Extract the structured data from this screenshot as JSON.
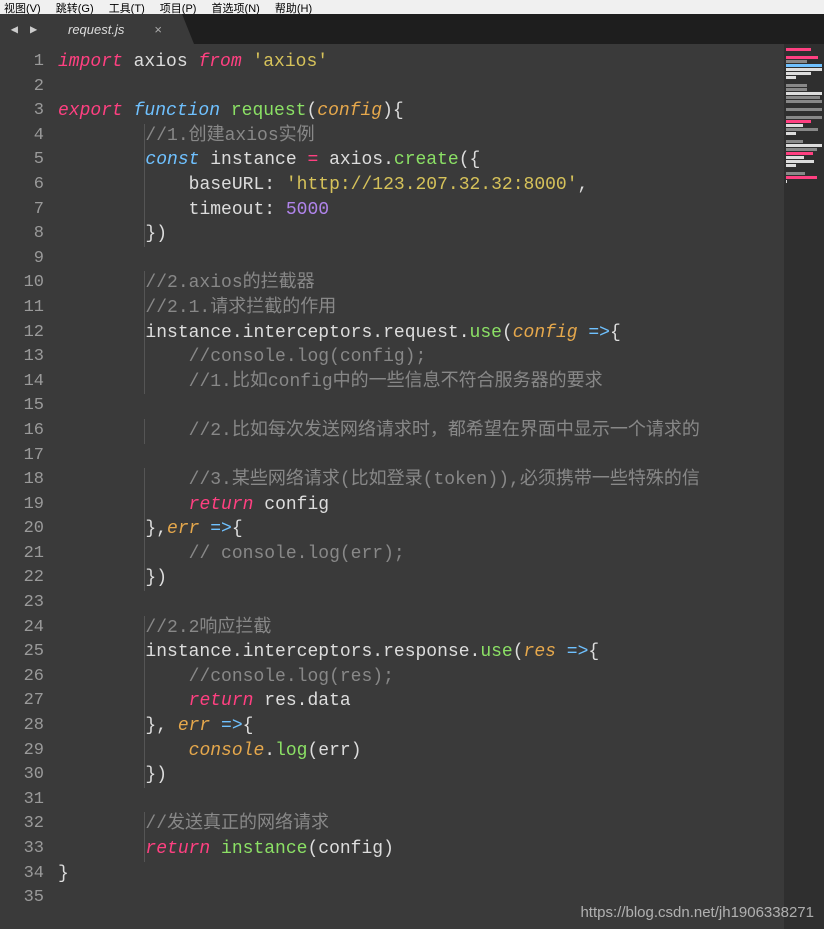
{
  "menubar": {
    "items": [
      "视图(V)",
      "跳转(G)",
      "工具(T)",
      "项目(P)",
      "首选项(N)",
      "帮助(H)"
    ]
  },
  "tab": {
    "filename": "request.js",
    "close_label": "×"
  },
  "nav": {
    "back": "◀",
    "forward": "▶"
  },
  "code": {
    "lines": [
      [
        {
          "t": "import ",
          "c": "kw"
        },
        {
          "t": "axios ",
          "c": "ident"
        },
        {
          "t": "from ",
          "c": "kw"
        },
        {
          "t": "'axios'",
          "c": "str"
        }
      ],
      [],
      [
        {
          "t": "export ",
          "c": "kw"
        },
        {
          "t": "function ",
          "c": "kw2"
        },
        {
          "t": "request",
          "c": "fn"
        },
        {
          "t": "(",
          "c": "punct"
        },
        {
          "t": "config",
          "c": "param"
        },
        {
          "t": "){",
          "c": "punct"
        }
      ],
      [
        {
          "t": "        ",
          "c": ""
        },
        {
          "t": "//1.创建axios实例",
          "c": "comment"
        }
      ],
      [
        {
          "t": "        ",
          "c": ""
        },
        {
          "t": "const ",
          "c": "kw2"
        },
        {
          "t": "instance ",
          "c": "ident"
        },
        {
          "t": "= ",
          "c": "kw"
        },
        {
          "t": "axios",
          "c": "ident"
        },
        {
          "t": ".",
          "c": "punct"
        },
        {
          "t": "create",
          "c": "fn"
        },
        {
          "t": "({",
          "c": "punct"
        }
      ],
      [
        {
          "t": "            ",
          "c": ""
        },
        {
          "t": "baseURL",
          "c": "ident"
        },
        {
          "t": ": ",
          "c": "punct"
        },
        {
          "t": "'http://123.207.32.32:8000'",
          "c": "str"
        },
        {
          "t": ",",
          "c": "punct"
        }
      ],
      [
        {
          "t": "            ",
          "c": ""
        },
        {
          "t": "timeout",
          "c": "ident"
        },
        {
          "t": ": ",
          "c": "punct"
        },
        {
          "t": "5000",
          "c": "num"
        }
      ],
      [
        {
          "t": "        ",
          "c": ""
        },
        {
          "t": "})",
          "c": "punct"
        }
      ],
      [],
      [
        {
          "t": "        ",
          "c": ""
        },
        {
          "t": "//2.axios的拦截器",
          "c": "comment"
        }
      ],
      [
        {
          "t": "        ",
          "c": ""
        },
        {
          "t": "//2.1.请求拦截的作用",
          "c": "comment"
        }
      ],
      [
        {
          "t": "        ",
          "c": ""
        },
        {
          "t": "instance",
          "c": "ident"
        },
        {
          "t": ".",
          "c": "punct"
        },
        {
          "t": "interceptors",
          "c": "ident"
        },
        {
          "t": ".",
          "c": "punct"
        },
        {
          "t": "request",
          "c": "ident"
        },
        {
          "t": ".",
          "c": "punct"
        },
        {
          "t": "use",
          "c": "fn"
        },
        {
          "t": "(",
          "c": "punct"
        },
        {
          "t": "config ",
          "c": "param"
        },
        {
          "t": "=>",
          "c": "kw2"
        },
        {
          "t": "{",
          "c": "punct"
        }
      ],
      [
        {
          "t": "            ",
          "c": ""
        },
        {
          "t": "//console.log(config);",
          "c": "comment"
        }
      ],
      [
        {
          "t": "            ",
          "c": ""
        },
        {
          "t": "//1.比如config中的一些信息不符合服务器的要求",
          "c": "comment"
        }
      ],
      [],
      [
        {
          "t": "            ",
          "c": ""
        },
        {
          "t": "//2.比如每次发送网络请求时，都希望在界面中显示一个请求的",
          "c": "comment"
        }
      ],
      [],
      [
        {
          "t": "            ",
          "c": ""
        },
        {
          "t": "//3.某些网络请求(比如登录(token)),必须携带一些特殊的信",
          "c": "comment"
        }
      ],
      [
        {
          "t": "            ",
          "c": ""
        },
        {
          "t": "return ",
          "c": "kw"
        },
        {
          "t": "config",
          "c": "ident"
        }
      ],
      [
        {
          "t": "        ",
          "c": ""
        },
        {
          "t": "},",
          "c": "punct"
        },
        {
          "t": "err ",
          "c": "param"
        },
        {
          "t": "=>",
          "c": "kw2"
        },
        {
          "t": "{",
          "c": "punct"
        }
      ],
      [
        {
          "t": "            ",
          "c": ""
        },
        {
          "t": "// console.log(err);",
          "c": "comment"
        }
      ],
      [
        {
          "t": "        ",
          "c": ""
        },
        {
          "t": "})",
          "c": "punct"
        }
      ],
      [],
      [
        {
          "t": "        ",
          "c": ""
        },
        {
          "t": "//2.2响应拦截",
          "c": "comment"
        }
      ],
      [
        {
          "t": "        ",
          "c": ""
        },
        {
          "t": "instance",
          "c": "ident"
        },
        {
          "t": ".",
          "c": "punct"
        },
        {
          "t": "interceptors",
          "c": "ident"
        },
        {
          "t": ".",
          "c": "punct"
        },
        {
          "t": "response",
          "c": "ident"
        },
        {
          "t": ".",
          "c": "punct"
        },
        {
          "t": "use",
          "c": "fn"
        },
        {
          "t": "(",
          "c": "punct"
        },
        {
          "t": "res ",
          "c": "param"
        },
        {
          "t": "=>",
          "c": "kw2"
        },
        {
          "t": "{",
          "c": "punct"
        }
      ],
      [
        {
          "t": "            ",
          "c": ""
        },
        {
          "t": "//console.log(res);",
          "c": "comment"
        }
      ],
      [
        {
          "t": "            ",
          "c": ""
        },
        {
          "t": "return ",
          "c": "kw"
        },
        {
          "t": "res",
          "c": "ident"
        },
        {
          "t": ".",
          "c": "punct"
        },
        {
          "t": "data",
          "c": "ident"
        }
      ],
      [
        {
          "t": "        ",
          "c": ""
        },
        {
          "t": "}, ",
          "c": "punct"
        },
        {
          "t": "err ",
          "c": "param"
        },
        {
          "t": "=>",
          "c": "kw2"
        },
        {
          "t": "{",
          "c": "punct"
        }
      ],
      [
        {
          "t": "            ",
          "c": ""
        },
        {
          "t": "console",
          "c": "param"
        },
        {
          "t": ".",
          "c": "punct"
        },
        {
          "t": "log",
          "c": "fn"
        },
        {
          "t": "(err)",
          "c": "punct"
        }
      ],
      [
        {
          "t": "        ",
          "c": ""
        },
        {
          "t": "})",
          "c": "punct"
        }
      ],
      [],
      [
        {
          "t": "        ",
          "c": ""
        },
        {
          "t": "//发送真正的网络请求",
          "c": "comment"
        }
      ],
      [
        {
          "t": "        ",
          "c": ""
        },
        {
          "t": "return ",
          "c": "kw"
        },
        {
          "t": "instance",
          "c": "fn"
        },
        {
          "t": "(config)",
          "c": "punct"
        }
      ],
      [
        {
          "t": "}",
          "c": "punct"
        }
      ],
      []
    ]
  },
  "watermark": "https://blog.csdn.net/jh1906338271"
}
